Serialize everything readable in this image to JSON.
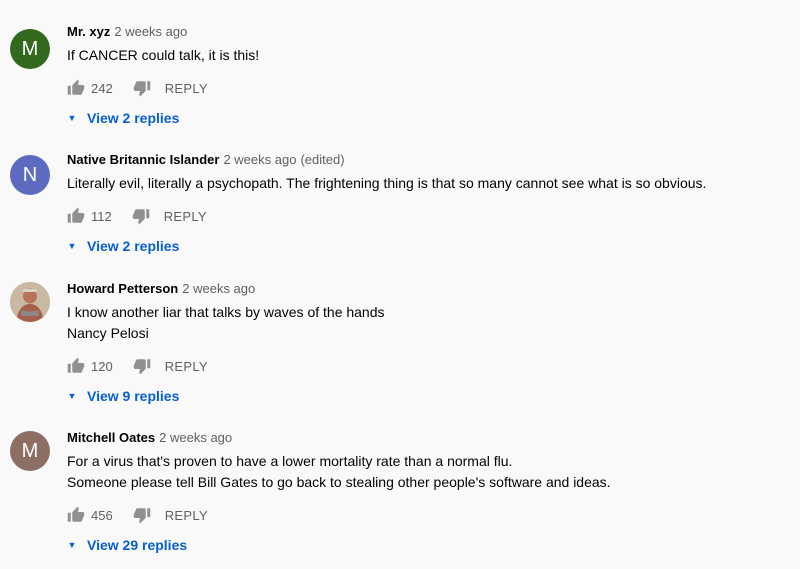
{
  "comments": [
    {
      "avatar_letter": "M",
      "avatar_color": "#33691e",
      "author": "Mr. xyz",
      "time": "2 weeks ago",
      "edited": "",
      "lines": [
        "If CANCER could talk, it is this!"
      ],
      "likes": "242",
      "reply_label": "REPLY",
      "view_replies": "View 2 replies"
    },
    {
      "avatar_letter": "N",
      "avatar_color": "#5c6bc0",
      "author": "Native Britannic Islander",
      "time": "2 weeks ago",
      "edited": "(edited)",
      "lines": [
        "Literally evil, literally a psychopath. The frightening thing is that so many cannot see what is so obvious."
      ],
      "likes": "112",
      "reply_label": "REPLY",
      "view_replies": "View 2 replies"
    },
    {
      "avatar_letter": "",
      "avatar_color": "#b7a48f",
      "author": "Howard Petterson",
      "time": "2 weeks ago",
      "edited": "",
      "lines": [
        "I know another liar that talks by waves of the hands",
        "Nancy Pelosi"
      ],
      "likes": "120",
      "reply_label": "REPLY",
      "view_replies": "View 9 replies"
    },
    {
      "avatar_letter": "M",
      "avatar_color": "#8d6e63",
      "author": "Mitchell Oates",
      "time": "2 weeks ago",
      "edited": "",
      "lines": [
        "For a virus that's proven to have a lower mortality rate than a normal flu.",
        "Someone please tell Bill Gates to go back to stealing other people's software and ideas."
      ],
      "likes": "456",
      "reply_label": "REPLY",
      "view_replies": "View 29 replies"
    }
  ],
  "icons": {
    "like": "thumb-up-icon",
    "dislike": "thumb-down-icon",
    "expand": "caret-down-icon"
  },
  "colors": {
    "link": "#065fd4",
    "meta": "#606060",
    "icon": "#909090"
  }
}
